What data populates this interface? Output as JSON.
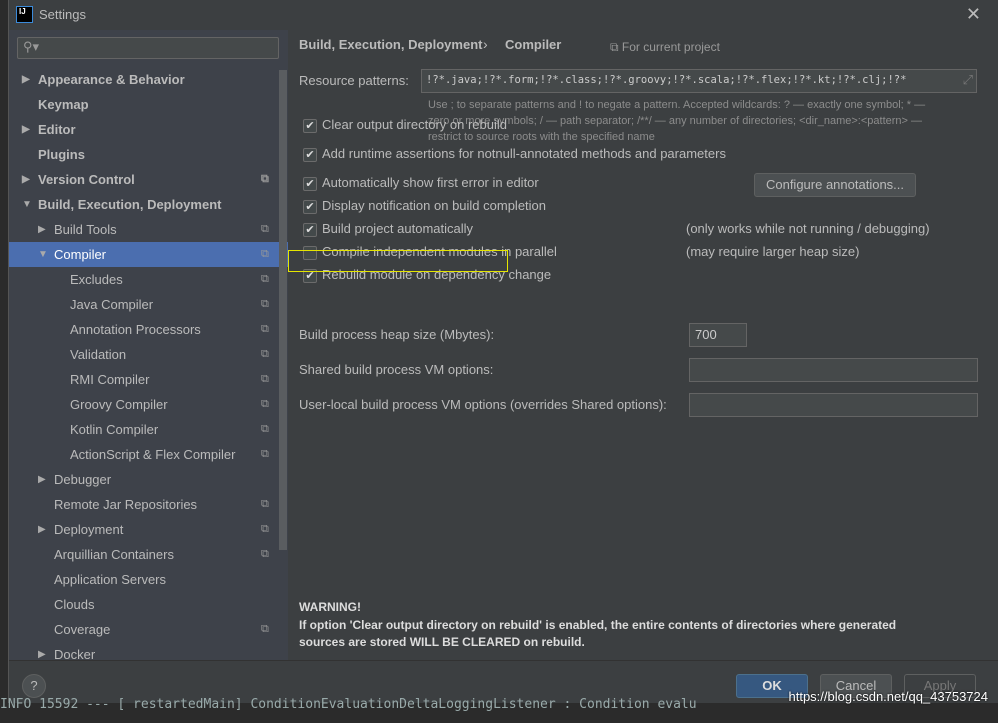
{
  "window": {
    "title": "Settings",
    "logo": "IJ",
    "close": "✕"
  },
  "sidebar": {
    "search_placeholder": "",
    "items": [
      {
        "label": "Appearance & Behavior",
        "bold": true,
        "arrow": "▶",
        "level": 0
      },
      {
        "label": "Keymap",
        "bold": true,
        "level": 0
      },
      {
        "label": "Editor",
        "bold": true,
        "arrow": "▶",
        "level": 0
      },
      {
        "label": "Plugins",
        "bold": true,
        "level": 0
      },
      {
        "label": "Version Control",
        "bold": true,
        "arrow": "▶",
        "level": 0,
        "copy": true
      },
      {
        "label": "Build, Execution, Deployment",
        "bold": true,
        "arrow": "▼",
        "level": 0
      },
      {
        "label": "Build Tools",
        "arrow": "▶",
        "level": 1,
        "copy": true
      },
      {
        "label": "Compiler",
        "arrow": "▼",
        "level": 1,
        "copy": true,
        "selected": true
      },
      {
        "label": "Excludes",
        "level": 2,
        "copy": true
      },
      {
        "label": "Java Compiler",
        "level": 2,
        "copy": true
      },
      {
        "label": "Annotation Processors",
        "level": 2,
        "copy": true
      },
      {
        "label": "Validation",
        "level": 2,
        "copy": true
      },
      {
        "label": "RMI Compiler",
        "level": 2,
        "copy": true
      },
      {
        "label": "Groovy Compiler",
        "level": 2,
        "copy": true
      },
      {
        "label": "Kotlin Compiler",
        "level": 2,
        "copy": true
      },
      {
        "label": "ActionScript & Flex Compiler",
        "level": 2,
        "copy": true
      },
      {
        "label": "Debugger",
        "arrow": "▶",
        "level": 1
      },
      {
        "label": "Remote Jar Repositories",
        "level": 1,
        "copy": true
      },
      {
        "label": "Deployment",
        "arrow": "▶",
        "level": 1,
        "copy": true
      },
      {
        "label": "Arquillian Containers",
        "level": 1,
        "copy": true
      },
      {
        "label": "Application Servers",
        "level": 1
      },
      {
        "label": "Clouds",
        "level": 1
      },
      {
        "label": "Coverage",
        "level": 1,
        "copy": true
      },
      {
        "label": "Docker",
        "arrow": "▶",
        "level": 1
      }
    ]
  },
  "main": {
    "breadcrumb": {
      "parent": "Build, Execution, Deployment",
      "sep": "›",
      "current": "Compiler",
      "scope": "For current project"
    },
    "resource_label": "Resource patterns:",
    "resource_value": "!?*.java;!?*.form;!?*.class;!?*.groovy;!?*.scala;!?*.flex;!?*.kt;!?*.clj;!?*",
    "hint1": "Use ; to separate patterns and ! to negate a pattern. Accepted wildcards: ? — exactly one symbol; * —",
    "hint2": "zero or more symbols; / — path separator; /**/ — any number of directories; <dir_name>:<pattern> —",
    "hint3": "restrict to source roots with the specified name",
    "checks": [
      {
        "label": "Clear output directory on rebuild",
        "checked": true
      },
      {
        "label": "Add runtime assertions for notnull-annotated methods and parameters",
        "checked": true
      },
      {
        "label": "Automatically show first error in editor",
        "checked": true
      },
      {
        "label": "Display notification on build completion",
        "checked": true
      },
      {
        "label": "Build project automatically",
        "checked": true,
        "note": "(only works while not running / debugging)"
      },
      {
        "label": "Compile independent modules in parallel",
        "checked": false,
        "note": "(may require larger heap size)"
      },
      {
        "label": "Rebuild module on dependency change",
        "checked": true
      }
    ],
    "configure_button": "Configure annotations...",
    "heap_label": "Build process heap size (Mbytes):",
    "heap_value": "700",
    "shared_label": "Shared build process VM options:",
    "shared_value": "",
    "user_label": "User-local build process VM options (overrides Shared options):",
    "user_value": "",
    "warning_title": "WARNING!",
    "warning1": "If option 'Clear output directory on rebuild' is enabled, the entire contents of directories where generated",
    "warning2": "sources are stored WILL BE CLEARED on rebuild."
  },
  "footer": {
    "help": "?",
    "ok": "OK",
    "cancel": "Cancel",
    "apply": "Apply"
  },
  "background_text": "INFO 15592 --- [  restartedMain] ConditionEvaluationDeltaLoggingListener : Condition evalu",
  "watermark": "https://blog.csdn.net/qq_43753724",
  "colors": {
    "selection": "#4b6eaf",
    "highlight_box": "#e5e500",
    "ok_button": "#365880"
  }
}
